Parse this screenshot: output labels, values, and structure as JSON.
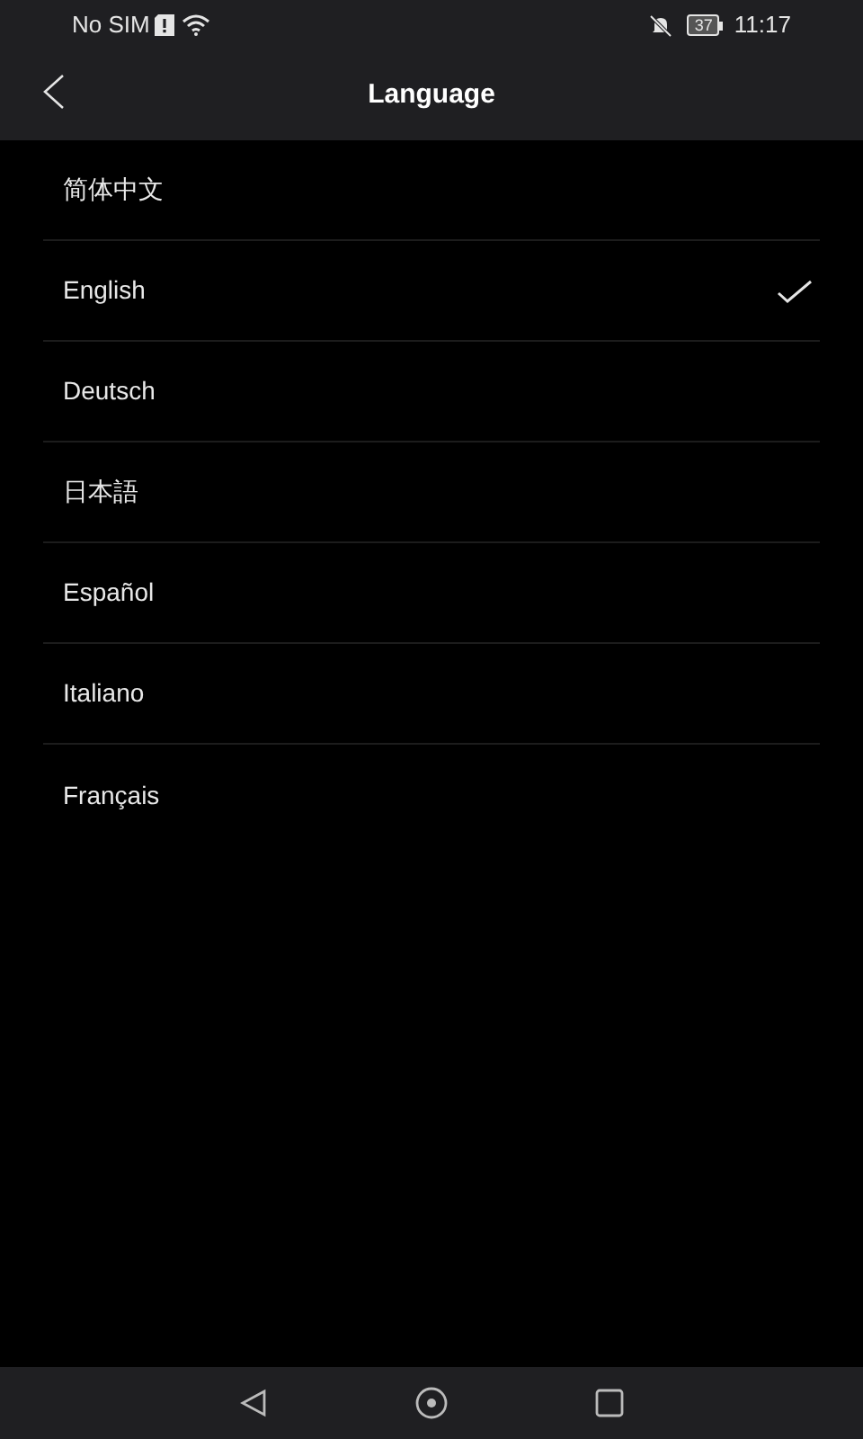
{
  "status_bar": {
    "carrier": "No SIM",
    "battery": "37",
    "time": "11:17"
  },
  "header": {
    "title": "Language"
  },
  "languages": [
    {
      "label": "简体中文",
      "selected": false
    },
    {
      "label": "English",
      "selected": true
    },
    {
      "label": "Deutsch",
      "selected": false
    },
    {
      "label": "日本語",
      "selected": false
    },
    {
      "label": "Español",
      "selected": false
    },
    {
      "label": "Italiano",
      "selected": false
    },
    {
      "label": "Français",
      "selected": false
    }
  ]
}
